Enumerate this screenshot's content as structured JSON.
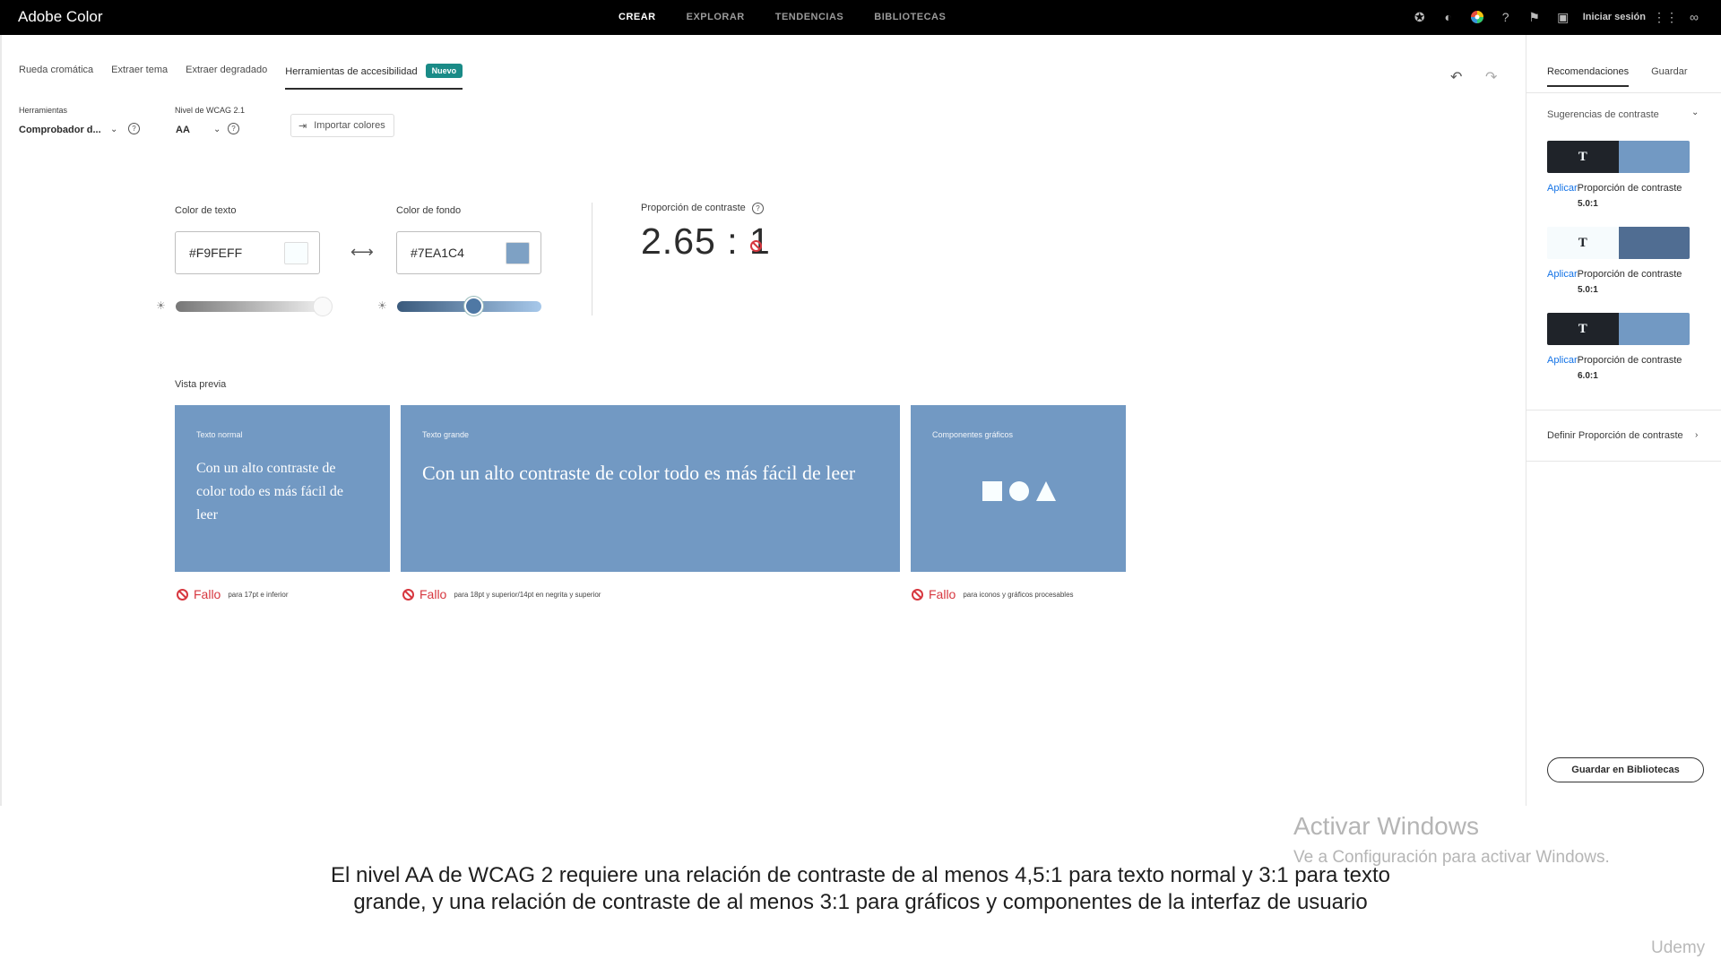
{
  "app": {
    "title": "Adobe Color"
  },
  "topnav": {
    "items": [
      "CREAR",
      "EXPLORAR",
      "TENDENCIAS",
      "BIBLIOTECAS"
    ],
    "active": "CREAR",
    "signin": "Iniciar sesión",
    "icons": [
      "star-icon",
      "moon-icon",
      "color-wheel-icon",
      "help-icon",
      "feedback-icon",
      "chat-icon",
      "apps-grid-icon",
      "creative-cloud-icon"
    ]
  },
  "tabs": {
    "items": [
      "Rueda cromática",
      "Extraer tema",
      "Extraer degradado",
      "Herramientas de accesibilidad"
    ],
    "badge": "Nuevo"
  },
  "controls": {
    "tools_label": "Herramientas",
    "tools_value": "Comprobador d...",
    "wcag_label": "Nivel de WCAG 2.1",
    "wcag_value": "AA",
    "import_label": "Importar colores"
  },
  "colors": {
    "text_label": "Color de texto",
    "text_value": "#F9FEFF",
    "text_hex": "#F9FEFF",
    "bg_label": "Color de fondo",
    "bg_value": "#7EA1C4",
    "bg_hex": "#7EA1C4",
    "text_brightness_level": 1.0,
    "bg_brightness_level": 0.53
  },
  "contrast": {
    "label": "Proporción de contraste",
    "value": "2.65 : 1"
  },
  "preview": {
    "label": "Vista previa",
    "cards": [
      {
        "title": "Texto normal",
        "body": "Con un alto contraste de color todo es más fácil de leer",
        "status": "Fallo",
        "detail": "para 17pt e inferior"
      },
      {
        "title": "Texto grande",
        "body": "Con un alto contraste de color todo es más fácil de leer",
        "status": "Fallo",
        "detail": "para 18pt y superior/14pt en negrita y superior"
      },
      {
        "title": "Componentes gráficos",
        "status": "Fallo",
        "detail": "para iconos y gráficos procesables",
        "shapes": [
          "square-icon",
          "circle-icon",
          "triangle-icon"
        ]
      }
    ]
  },
  "right": {
    "tabs": [
      "Recomendaciones",
      "Guardar"
    ],
    "suggestions_title": "Sugerencias de contraste",
    "suggestions": [
      {
        "text_color": "#1f2329",
        "bg_color": "#7299c3",
        "glyph": "T",
        "apply": "Aplicar",
        "label": "Proporción de contraste",
        "value": "5.0:1"
      },
      {
        "text_color": "#f6fbfd",
        "bg_color": "#506d92",
        "glyph": "T",
        "apply": "Aplicar",
        "label": "Proporción de contraste",
        "value": "5.0:1"
      },
      {
        "text_color": "#1f2329",
        "bg_color": "#7299c3",
        "glyph": "T",
        "apply": "Aplicar",
        "label": "Proporción de contraste",
        "value": "6.0:1"
      }
    ],
    "define": "Definir Proporción de contraste",
    "save_button": "Guardar en Bibliotecas"
  },
  "watermark": {
    "line1": "Activar Windows",
    "line2": "Ve a Configuración para activar Windows."
  },
  "caption": {
    "line1": "El nivel AA de WCAG 2 requiere una relación de contraste de al menos 4,5:1 para texto normal y 3:1 para texto",
    "line2": "grande, y una relación de contraste de al menos 3:1 para gráficos y componentes de la interfaz de usuario"
  },
  "brand_watermark": "Udemy"
}
